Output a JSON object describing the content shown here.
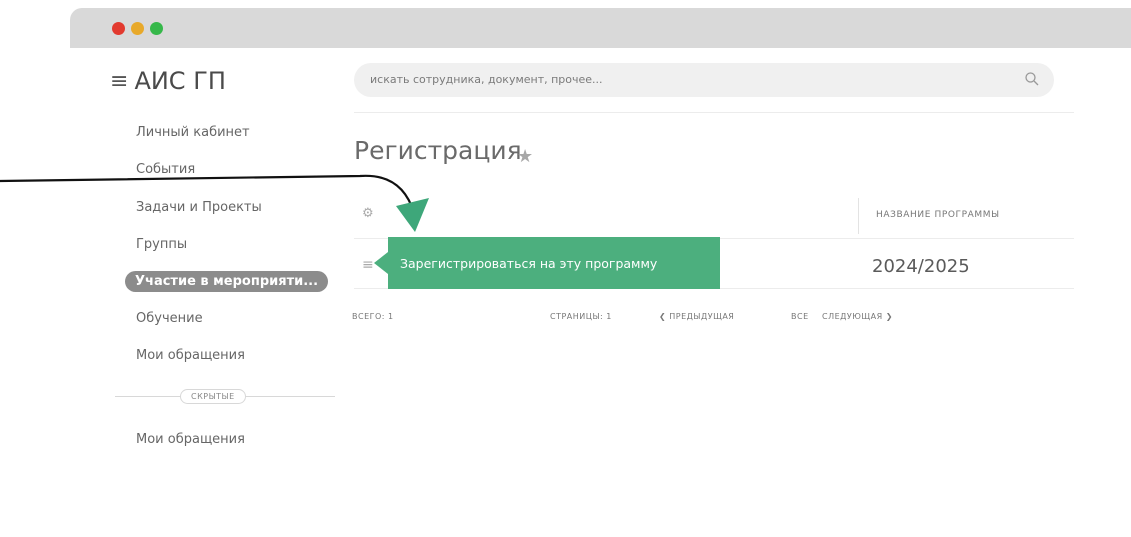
{
  "window": {
    "controls": [
      "close",
      "minimize",
      "maximize"
    ]
  },
  "app": {
    "logo_menu_icon": "≡",
    "logo_text": "АИС ГП"
  },
  "search": {
    "placeholder": "искать сотрудника, документ, прочее...",
    "icon": "search-icon"
  },
  "sidebar": {
    "items": [
      {
        "label": "Личный кабинет"
      },
      {
        "label": "События"
      },
      {
        "label": "Задачи и Проекты"
      },
      {
        "label": "Группы"
      },
      {
        "label": "Участие в мероприяти...",
        "active": true
      },
      {
        "label": "Обучение"
      },
      {
        "label": "Мои обращения"
      }
    ],
    "hidden_label": "СКРЫТЫЕ",
    "hidden_items": [
      {
        "label": "Мои обращения"
      }
    ]
  },
  "main": {
    "title": "Регистрация",
    "star_icon": "★",
    "table": {
      "settings_icon": "⚙",
      "columns": [
        "НАЗВАНИЕ ПРОГРАММЫ"
      ],
      "rows": [
        {
          "menu_icon": "≡",
          "program": "2024/2025"
        }
      ]
    },
    "footer": {
      "total": "ВСЕГО: 1",
      "pages": "СТРАНИЦЫ: 1",
      "prev": "❮ ПРЕДЫДУЩАЯ",
      "all": "ВСЕ",
      "next": "СЛЕДУЮЩАЯ ❯"
    }
  },
  "tooltip": {
    "text": "Зарегистрироваться на эту программу",
    "color": "#4caf7e"
  },
  "colors": {
    "active_nav": "#8c8c8c",
    "close": "#e23a2f",
    "minimize": "#e8a92a",
    "maximize": "#36b84a"
  }
}
